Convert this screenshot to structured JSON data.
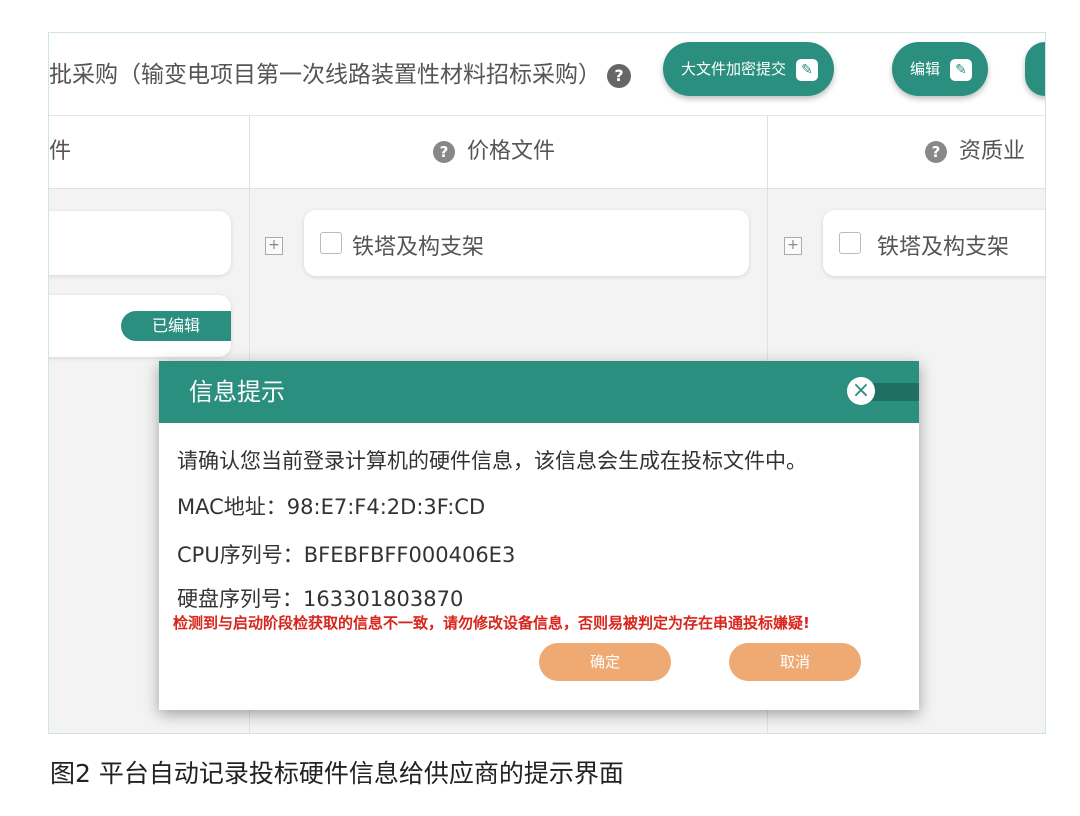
{
  "header": {
    "title": "批采购（输变电项目第一次线路装置性材料招标采购）",
    "help_icon": "question-circle-icon",
    "upload_button": "大文件加密提交",
    "edit_button": "编辑",
    "edit_icon": "edit-icon"
  },
  "columns": {
    "left_partial": "件",
    "price": "价格文件",
    "qualification_partial": "资质业"
  },
  "cards": {
    "price_item": "铁塔及构支架",
    "qual_item": "铁塔及构支架",
    "edited_badge": "已编辑",
    "expand_symbol": "+"
  },
  "modal": {
    "title": "信息提示",
    "close_symbol": "×",
    "intro": "请确认您当前登录计算机的硬件信息，该信息会生成在投标文件中。",
    "mac_label": "MAC地址：",
    "mac_value": "98:E7:F4:2D:3F:CD",
    "cpu_label": "CPU序列号：",
    "cpu_value": "BFEBFBFF000406E3",
    "disk_label": "硬盘序列号：",
    "disk_value": "163301803870",
    "warning": "检测到与启动阶段检获取的信息不一致，请勿修改设备信息，否则易被判定为存在串通投标嫌疑!",
    "ok_button": "确定",
    "cancel_button": "取消"
  },
  "caption": "图2  平台自动记录投标硬件信息给供应商的提示界面",
  "colors": {
    "accent": "#2b8f80",
    "button_orange": "#eeaa72",
    "warning_red": "#d8261c"
  }
}
